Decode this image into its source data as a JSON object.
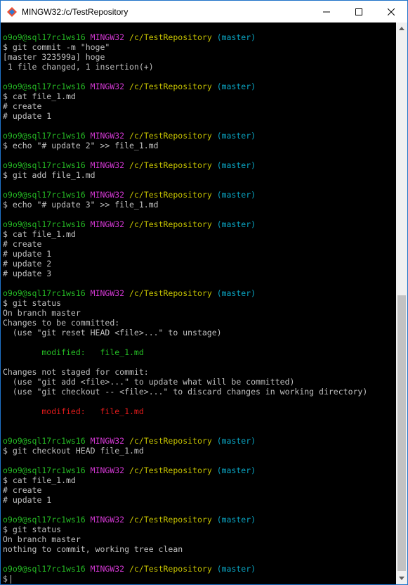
{
  "window": {
    "title": "MINGW32:/c/TestRepository",
    "controls": {
      "minimize_icon": "minimize-icon",
      "maximize_icon": "maximize-icon",
      "close_icon": "close-icon"
    }
  },
  "colors": {
    "background": "#000000",
    "text": "#c0c0c0",
    "user_host": "#25bc24",
    "mingw": "#d338d3",
    "path": "#c7c400",
    "branch": "#0aa7c5",
    "staged": "#25bc24",
    "unstaged": "#e01b1b"
  },
  "prompt": {
    "user_host": "o9o9@sql17rc1ws16",
    "system": "MINGW32",
    "path": "/c/TestRepository",
    "branch": "(master)"
  },
  "terminal": {
    "lines": [
      {
        "type": "prompt"
      },
      {
        "type": "text",
        "text": "$ git commit -m \"hoge\""
      },
      {
        "type": "text",
        "text": "[master 323599a] hoge"
      },
      {
        "type": "text",
        "text": " 1 file changed, 1 insertion(+)"
      },
      {
        "type": "blank"
      },
      {
        "type": "prompt"
      },
      {
        "type": "text",
        "text": "$ cat file_1.md"
      },
      {
        "type": "text",
        "text": "# create"
      },
      {
        "type": "text",
        "text": "# update 1"
      },
      {
        "type": "blank"
      },
      {
        "type": "prompt"
      },
      {
        "type": "text",
        "text": "$ echo \"# update 2\" >> file_1.md"
      },
      {
        "type": "blank"
      },
      {
        "type": "prompt"
      },
      {
        "type": "text",
        "text": "$ git add file_1.md"
      },
      {
        "type": "blank"
      },
      {
        "type": "prompt"
      },
      {
        "type": "text",
        "text": "$ echo \"# update 3\" >> file_1.md"
      },
      {
        "type": "blank"
      },
      {
        "type": "prompt"
      },
      {
        "type": "text",
        "text": "$ cat file_1.md"
      },
      {
        "type": "text",
        "text": "# create"
      },
      {
        "type": "text",
        "text": "# update 1"
      },
      {
        "type": "text",
        "text": "# update 2"
      },
      {
        "type": "text",
        "text": "# update 3"
      },
      {
        "type": "blank"
      },
      {
        "type": "prompt"
      },
      {
        "type": "text",
        "text": "$ git status"
      },
      {
        "type": "text",
        "text": "On branch master"
      },
      {
        "type": "text",
        "text": "Changes to be committed:"
      },
      {
        "type": "text",
        "text": "  (use \"git reset HEAD <file>...\" to unstage)"
      },
      {
        "type": "blank"
      },
      {
        "type": "staged",
        "text": "        modified:   file_1.md"
      },
      {
        "type": "blank"
      },
      {
        "type": "text",
        "text": "Changes not staged for commit:"
      },
      {
        "type": "text",
        "text": "  (use \"git add <file>...\" to update what will be committed)"
      },
      {
        "type": "text",
        "text": "  (use \"git checkout -- <file>...\" to discard changes in working directory)"
      },
      {
        "type": "blank"
      },
      {
        "type": "unstaged",
        "text": "        modified:   file_1.md"
      },
      {
        "type": "blank"
      },
      {
        "type": "blank"
      },
      {
        "type": "prompt"
      },
      {
        "type": "text",
        "text": "$ git checkout HEAD file_1.md"
      },
      {
        "type": "blank"
      },
      {
        "type": "prompt"
      },
      {
        "type": "text",
        "text": "$ cat file_1.md"
      },
      {
        "type": "text",
        "text": "# create"
      },
      {
        "type": "text",
        "text": "# update 1"
      },
      {
        "type": "blank"
      },
      {
        "type": "prompt"
      },
      {
        "type": "text",
        "text": "$ git status"
      },
      {
        "type": "text",
        "text": "On branch master"
      },
      {
        "type": "text",
        "text": "nothing to commit, working tree clean"
      },
      {
        "type": "blank"
      },
      {
        "type": "prompt"
      },
      {
        "type": "input",
        "text": "$"
      }
    ]
  },
  "scrollbar": {
    "up_icon": "scroll-up-arrow-icon",
    "down_icon": "scroll-down-arrow-icon"
  }
}
